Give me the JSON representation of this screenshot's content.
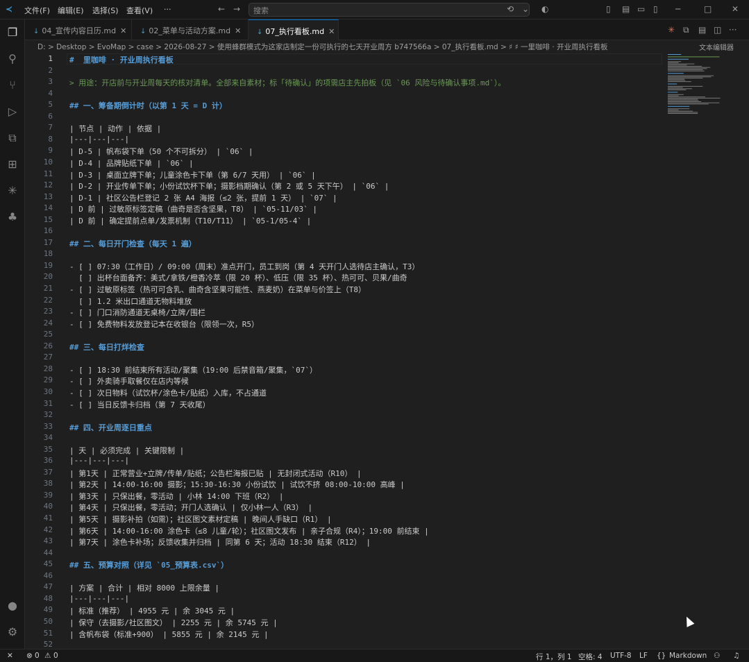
{
  "titlebar": {
    "menus": [
      "文件(F)",
      "编辑(E)",
      "选择(S)",
      "查看(V)",
      "···"
    ],
    "search_placeholder": "搜索"
  },
  "tabs": [
    {
      "label": "04_宣传内容日历.md",
      "active": false
    },
    {
      "label": "02_菜单与活动方案.md",
      "active": false
    },
    {
      "label": "07_执行看板.md",
      "active": true
    }
  ],
  "breadcrumb": {
    "path": "D: > Desktop > EvoMap > case > 2026-08-27 > 使用蜂群模式为这家店制定一份可执行的七天开业周方 b747566a > 07_执行看板.md > ♯ ♯ 一里咖啡 · 开业周执行看板",
    "right_label": "文本编辑器"
  },
  "editor": {
    "lines": [
      {
        "n": "1",
        "t": "#  里咖啡 · 开业周执行看板",
        "k": "h"
      },
      {
        "n": "2",
        "t": "",
        "k": ""
      },
      {
        "n": "3",
        "t": "> 用途：开店前与开业周每天的核对清单。全部来自素材；标「待确认」的项需店主先拍板（见 `06 风险与待确认事项.md`）。",
        "k": "q"
      },
      {
        "n": "4",
        "t": "",
        "k": ""
      },
      {
        "n": "5",
        "t": "## 一、筹备期倒计时（以第 1 天 = D 计）",
        "k": "h"
      },
      {
        "n": "6",
        "t": "",
        "k": ""
      },
      {
        "n": "7",
        "t": "| 节点 | 动作 | 依据 |",
        "k": ""
      },
      {
        "n": "8",
        "t": "|---|---|---|",
        "k": ""
      },
      {
        "n": "9",
        "t": "| D-5 | 帆布袋下单（50 个不可拆分） | `06` |",
        "k": ""
      },
      {
        "n": "10",
        "t": "| D-4 | 品牌贴纸下单 | `06` |",
        "k": ""
      },
      {
        "n": "11",
        "t": "| D-3 | 桌面立牌下单；儿童涂色卡下单（第 6/7 天用） | `06` |",
        "k": ""
      },
      {
        "n": "12",
        "t": "| D-2 | 开业传单下单；小份试饮杯下单；摄影档期确认（第 2 或 5 天下午） | `06` |",
        "k": ""
      },
      {
        "n": "13",
        "t": "| D-1 | 社区公告栏登记 2 张 A4 海报（≤2 张，提前 1 天） | `07` |",
        "k": ""
      },
      {
        "n": "14",
        "t": "| D 前 | 过敏原标签定稿（曲奇是否含坚果，T8） | `05-11/03` |",
        "k": ""
      },
      {
        "n": "15",
        "t": "| D 前 | 确定提前点单/发票机制（T10/T11） | `05-1/05-4` |",
        "k": ""
      },
      {
        "n": "16",
        "t": "",
        "k": ""
      },
      {
        "n": "17",
        "t": "## 二、每日开门检查（每天 1 遍）",
        "k": "h"
      },
      {
        "n": "18",
        "t": "",
        "k": ""
      },
      {
        "n": "19",
        "t": "- [ ] 07:30（工作日）/ 09:00（周末）准点开门，员工到岗（第 4 天开门人选待店主确认，T3）",
        "k": ""
      },
      {
        "n": "20",
        "t": "  [ ] 出杯台面备齐：美式/拿铁/橙香冷萃（限 20 杯）、低压（限 35 杯）、热可可、贝果/曲奇",
        "k": ""
      },
      {
        "n": "21",
        "t": "- [ ] 过敏原标签（热可可含乳、曲奇含坚果可能性、燕麦奶）在菜单与价签上（T8）",
        "k": ""
      },
      {
        "n": "22",
        "t": "  [ ] 1.2 米出口通道无物料堆放",
        "k": ""
      },
      {
        "n": "23",
        "t": "- [ ] 门口消防通道无桌椅/立牌/围栏",
        "k": ""
      },
      {
        "n": "24",
        "t": "- [ ] 免费物料发放登记本在收银台（限领一次，R5）",
        "k": ""
      },
      {
        "n": "25",
        "t": "",
        "k": ""
      },
      {
        "n": "26",
        "t": "## 三、每日打烊检查",
        "k": "h"
      },
      {
        "n": "27",
        "t": "",
        "k": ""
      },
      {
        "n": "28",
        "t": "- [ ] 18:30 前结束所有活动/聚集（19:00 后禁音箱/聚集，`07`）",
        "k": ""
      },
      {
        "n": "29",
        "t": "- [ ] 外卖骑手取餐仅在店内等候",
        "k": ""
      },
      {
        "n": "30",
        "t": "- [ ] 次日物料（试饮杯/涂色卡/贴纸）入库，不占通道",
        "k": ""
      },
      {
        "n": "31",
        "t": "- [ ] 当日反馈卡归档（第 7 天收尾）",
        "k": ""
      },
      {
        "n": "32",
        "t": "",
        "k": ""
      },
      {
        "n": "33",
        "t": "## 四、开业周逐日重点",
        "k": "h"
      },
      {
        "n": "34",
        "t": "",
        "k": ""
      },
      {
        "n": "35",
        "t": "| 天 | 必须完成 | 关键限制 |",
        "k": ""
      },
      {
        "n": "36",
        "t": "|---|---|---|",
        "k": ""
      },
      {
        "n": "37",
        "t": "| 第1天 | 正常营业+立牌/传单/贴纸；公告栏海报已贴 | 无封闭式活动（R10） |",
        "k": ""
      },
      {
        "n": "38",
        "t": "| 第2天 | 14:00-16:00 摄影；15:30-16:30 小份试饮 | 试饮不挤 08:00-10:00 高峰 |",
        "k": ""
      },
      {
        "n": "39",
        "t": "| 第3天 | 只保出餐，零活动 | 小林 14:00 下班（R2） |",
        "k": ""
      },
      {
        "n": "40",
        "t": "| 第4天 | 只保出餐，零活动；开门人选确认 | 仅小林一人（R3） |",
        "k": ""
      },
      {
        "n": "41",
        "t": "| 第5天 | 摄影补拍（如需）；社区图文素材定稿 | 晚间人手缺口（R1） |",
        "k": ""
      },
      {
        "n": "42",
        "t": "| 第6天 | 14:00-16:00 涂色卡（≤8 儿童/轮）；社区图文发布 | 亲子合规（R4）；19:00 前结束 |",
        "k": ""
      },
      {
        "n": "43",
        "t": "| 第7天 | 涂色卡补场；反馈收集并归档 | 同第 6 天；活动 18:30 结束（R12） |",
        "k": ""
      },
      {
        "n": "44",
        "t": "",
        "k": ""
      },
      {
        "n": "45",
        "t": "## 五、预算对照（详见 `05_预算表.csv`）",
        "k": "h"
      },
      {
        "n": "46",
        "t": "",
        "k": ""
      },
      {
        "n": "47",
        "t": "| 方案 | 合计 | 相对 8000 上限余量 |",
        "k": ""
      },
      {
        "n": "48",
        "t": "|---|---|---|",
        "k": ""
      },
      {
        "n": "49",
        "t": "| 标准（推荐） | 4955 元 | 余 3045 元 |",
        "k": ""
      },
      {
        "n": "50",
        "t": "| 保守（去摄影/社区图文） | 2255 元 | 余 5745 元 |",
        "k": ""
      },
      {
        "n": "51",
        "t": "| 含帆布袋（标准+900） | 5855 元 | 余 2145 元 |",
        "k": ""
      },
      {
        "n": "52",
        "t": "",
        "k": ""
      }
    ]
  },
  "statusbar": {
    "errors": "0",
    "warnings": "0",
    "position": "行 1，列 1",
    "spaces": "空格: 4",
    "encoding": "UTF-8",
    "eol": "LF",
    "language": "Markdown"
  },
  "colors": {
    "accent": "#0078d4",
    "heading": "#569cd6",
    "quote": "#6a9955",
    "code": "#ce9178"
  }
}
